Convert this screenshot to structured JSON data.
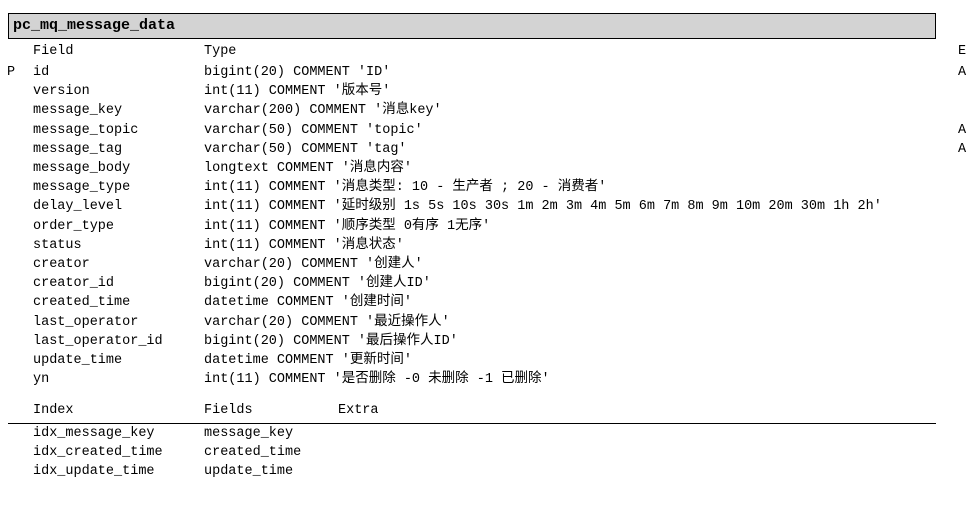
{
  "table": {
    "name": "pc_mq_message_data"
  },
  "columns_header": {
    "field": "Field",
    "type": "Type",
    "extra": "E"
  },
  "columns": [
    {
      "key": "P",
      "field": "id",
      "type": "bigint(20) COMMENT 'ID'",
      "extra": "A"
    },
    {
      "key": "",
      "field": "version",
      "type": "int(11) COMMENT '版本号'",
      "extra": ""
    },
    {
      "key": "",
      "field": "message_key",
      "type": "varchar(200) COMMENT '消息key'",
      "extra": ""
    },
    {
      "key": "",
      "field": "message_topic",
      "type": "varchar(50) COMMENT 'topic'",
      "extra": "A"
    },
    {
      "key": "",
      "field": "message_tag",
      "type": "varchar(50) COMMENT 'tag'",
      "extra": "A"
    },
    {
      "key": "",
      "field": "message_body",
      "type": "longtext COMMENT '消息内容'",
      "extra": ""
    },
    {
      "key": "",
      "field": "message_type",
      "type": "int(11) COMMENT '消息类型: 10 - 生产者 ; 20 - 消费者'",
      "extra": ""
    },
    {
      "key": "",
      "field": "delay_level",
      "type": "int(11) COMMENT '延时级别 1s 5s 10s 30s 1m 2m 3m 4m 5m 6m 7m 8m 9m 10m 20m 30m 1h 2h'",
      "extra": ""
    },
    {
      "key": "",
      "field": "order_type",
      "type": "int(11) COMMENT '顺序类型 0有序 1无序'",
      "extra": ""
    },
    {
      "key": "",
      "field": "status",
      "type": "int(11) COMMENT '消息状态'",
      "extra": ""
    },
    {
      "key": "",
      "field": "creator",
      "type": "varchar(20) COMMENT '创建人'",
      "extra": ""
    },
    {
      "key": "",
      "field": "creator_id",
      "type": "bigint(20) COMMENT '创建人ID'",
      "extra": ""
    },
    {
      "key": "",
      "field": "created_time",
      "type": "datetime COMMENT '创建时间'",
      "extra": ""
    },
    {
      "key": "",
      "field": "last_operator",
      "type": "varchar(20) COMMENT '最近操作人'",
      "extra": ""
    },
    {
      "key": "",
      "field": "last_operator_id",
      "type": "bigint(20) COMMENT '最后操作人ID'",
      "extra": ""
    },
    {
      "key": "",
      "field": "update_time",
      "type": "datetime COMMENT '更新时间'",
      "extra": ""
    },
    {
      "key": "",
      "field": "yn",
      "type": "int(11) COMMENT '是否删除 -0 未删除 -1 已删除'",
      "extra": ""
    }
  ],
  "index_header": {
    "index": "Index",
    "fields": "Fields",
    "extra": "Extra"
  },
  "indexes": [
    {
      "name": "idx_message_key",
      "fields": "message_key"
    },
    {
      "name": "idx_created_time",
      "fields": "created_time"
    },
    {
      "name": "idx_update_time",
      "fields": "update_time"
    }
  ]
}
